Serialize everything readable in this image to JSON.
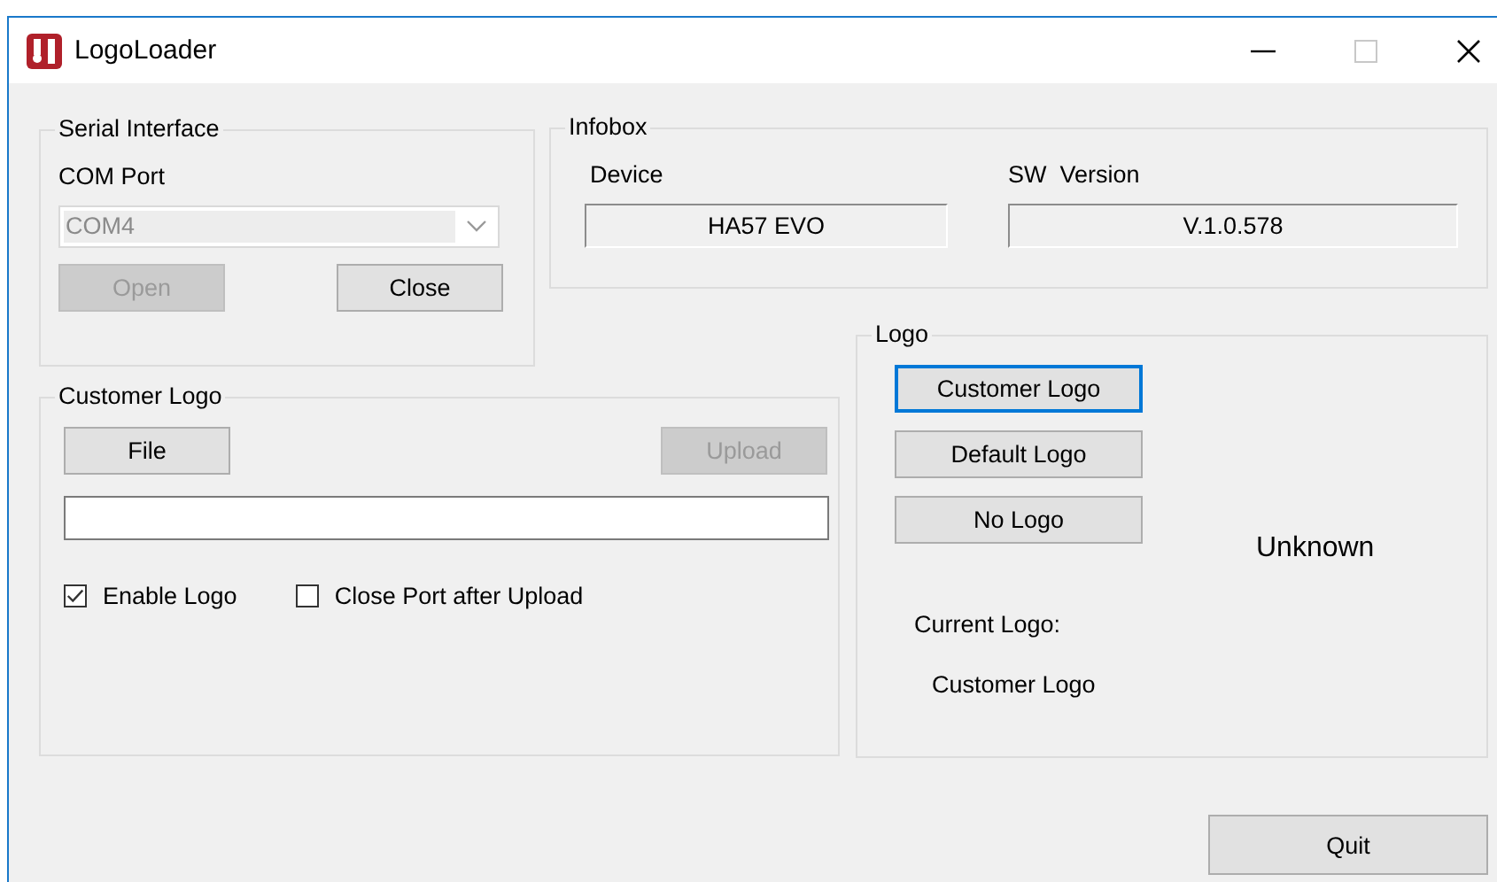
{
  "window": {
    "title": "LogoLoader"
  },
  "serial_interface": {
    "title": "Serial Interface",
    "com_port_label": "COM Port",
    "com_port": {
      "value": "COM4",
      "disabled": true
    },
    "buttons": [
      {
        "label": "Open",
        "disabled": true
      },
      {
        "label": "Close",
        "disabled": false
      }
    ]
  },
  "infobox": {
    "title": "Infobox",
    "fields": [
      {
        "label": "Device",
        "value": "HA57 EVO"
      },
      {
        "label": "SW  Version",
        "value": "V.1.0.578"
      }
    ]
  },
  "customer_logo": {
    "title": "Customer Logo",
    "file_button": {
      "label": "File",
      "disabled": false
    },
    "upload_button": {
      "label": "Upload",
      "disabled": true
    },
    "checkboxes": [
      {
        "label": "Enable Logo",
        "checked": true
      },
      {
        "label": "Close Port after Upload",
        "checked": false
      }
    ]
  },
  "logo": {
    "title": "Logo",
    "buttons": [
      {
        "label": "Customer Logo",
        "focused": true
      },
      {
        "label": "Default Logo",
        "focused": false
      },
      {
        "label": "No Logo",
        "focused": false
      }
    ],
    "status": "Unknown",
    "current_label": "Current Logo:",
    "current_value": "Customer Logo"
  },
  "quit_button": {
    "label": "Quit"
  }
}
